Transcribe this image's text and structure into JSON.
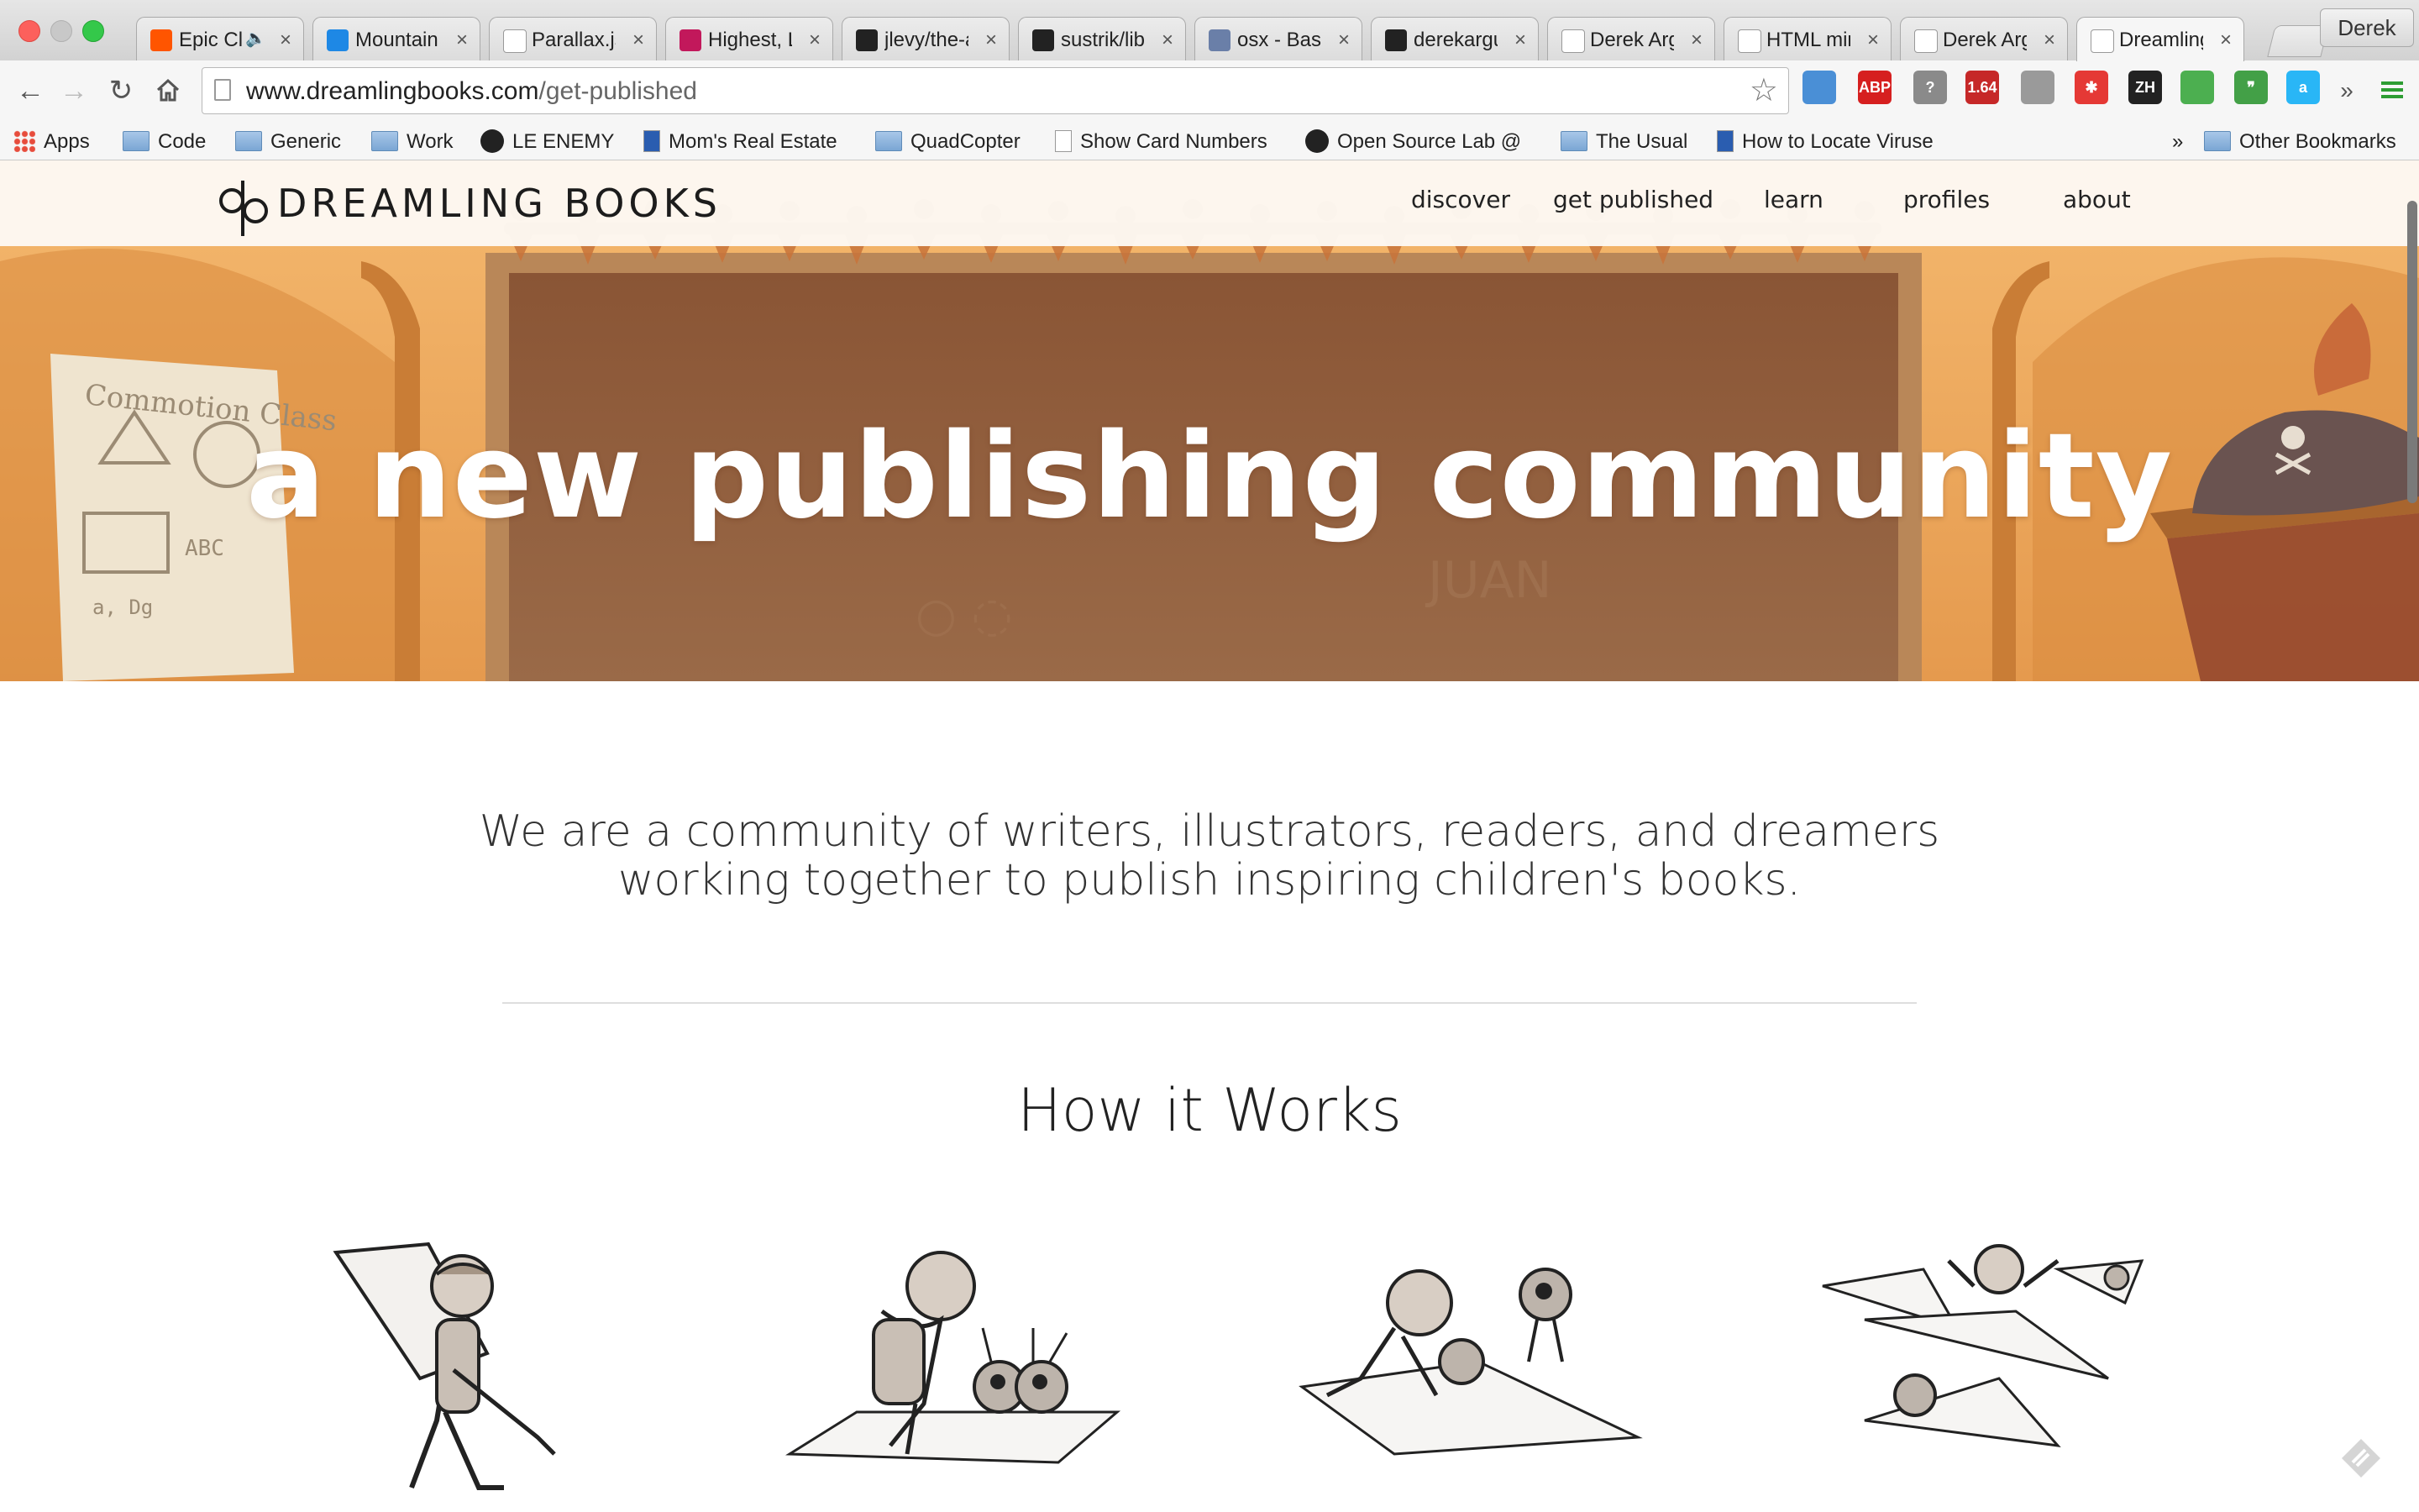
{
  "browser": {
    "profile": "Derek",
    "tabs": [
      {
        "title": "Epic Cl",
        "favicon": "soundcloud-icon",
        "color": "#ff5500",
        "active": false,
        "audio": true
      },
      {
        "title": "Mountainh",
        "favicon": "round-logo-icon",
        "color": "#1e88e5",
        "active": false
      },
      {
        "title": "Parallax.js",
        "favicon": "page-icon",
        "color": "#ffffff",
        "active": false
      },
      {
        "title": "Highest, L",
        "favicon": "flag-icon",
        "color": "#c2185b",
        "active": false
      },
      {
        "title": "jlevy/the-a",
        "favicon": "github-icon",
        "color": "#222222",
        "active": false
      },
      {
        "title": "sustrik/libr",
        "favicon": "github-icon",
        "color": "#222222",
        "active": false
      },
      {
        "title": "osx - Bash",
        "favicon": "unix-linux-icon",
        "color": "#6a7fa8",
        "active": false
      },
      {
        "title": "derekargue",
        "favicon": "github-icon",
        "color": "#222222",
        "active": false
      },
      {
        "title": "Derek Arg",
        "favicon": "page-icon",
        "color": "#ffffff",
        "active": false
      },
      {
        "title": "HTML min",
        "favicon": "page-icon",
        "color": "#ffffff",
        "active": false
      },
      {
        "title": "Derek Arg",
        "favicon": "page-icon",
        "color": "#ffffff",
        "active": false
      },
      {
        "title": "Dreamling",
        "favicon": "dreamling-logo-icon",
        "color": "#ffffff",
        "active": true
      }
    ],
    "url_host": "www.dreamlingbooks.com",
    "url_path": "/get-published",
    "extensions": [
      {
        "name": "screenshot-ext-icon",
        "label": "",
        "color": "#4a8fd6"
      },
      {
        "name": "adblock-plus-icon",
        "label": "ABP",
        "color": "#d61f1f"
      },
      {
        "name": "scale-ext-icon",
        "label": "?",
        "color": "#8a8a8a"
      },
      {
        "name": "speed-meter-icon",
        "label": "1.64",
        "color": "#c62828"
      },
      {
        "name": "boomerang-ext-icon",
        "label": "",
        "color": "#9a9a9a"
      },
      {
        "name": "lastpass-ext-icon",
        "label": "✱",
        "color": "#e53935"
      },
      {
        "name": "zh-ext-icon",
        "label": "ZH",
        "color": "#222222"
      },
      {
        "name": "pushbullet-ext-icon",
        "label": "",
        "color": "#4caf50"
      },
      {
        "name": "hangouts-ext-icon",
        "label": "❞",
        "color": "#43a047"
      },
      {
        "name": "amazon-assistant-icon",
        "label": "a",
        "color": "#29b6f6"
      }
    ],
    "bookmarks": [
      {
        "label": "Apps",
        "icon": "apps-icon"
      },
      {
        "label": "Code",
        "icon": "folder-icon"
      },
      {
        "label": "Generic",
        "icon": "folder-icon"
      },
      {
        "label": "Work",
        "icon": "folder-icon"
      },
      {
        "label": "LE ENEMY",
        "icon": "github-icon"
      },
      {
        "label": "Mom's Real Estate",
        "icon": "site-icon"
      },
      {
        "label": "QuadCopter",
        "icon": "folder-icon"
      },
      {
        "label": "Show Card Numbers",
        "icon": "page-icon"
      },
      {
        "label": "Open Source Lab @",
        "icon": "github-icon"
      },
      {
        "label": "The Usual",
        "icon": "folder-icon"
      },
      {
        "label": "How to Locate Viruse",
        "icon": "site-icon"
      }
    ],
    "bookmarks_overflow": "»",
    "other_bookmarks": "Other Bookmarks"
  },
  "site": {
    "brand": "DREAMLING BOOKS",
    "nav": [
      "discover",
      "get published",
      "learn",
      "profiles",
      "about"
    ],
    "hero_title": "a new publishing community",
    "intro": "We are a community of writers, illustrators, readers, and dreamers working together to publish inspiring children's books.",
    "section_title": "How it Works"
  }
}
